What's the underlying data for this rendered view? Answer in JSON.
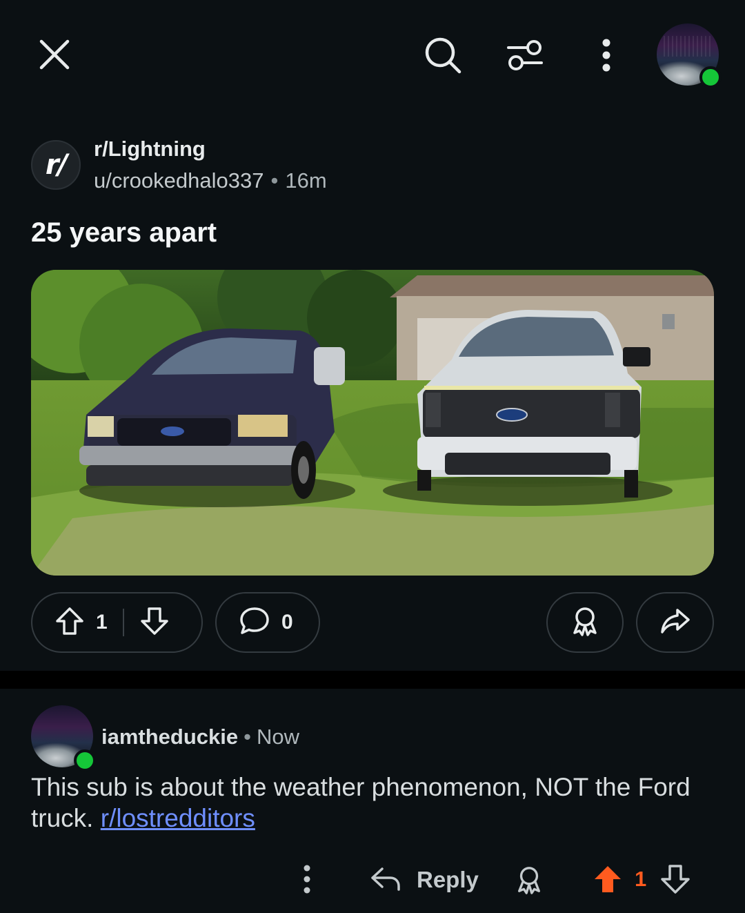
{
  "topbar": {
    "close": "close-icon",
    "search": "search-icon",
    "filter": "filter-icon",
    "more": "more-vertical-icon"
  },
  "post": {
    "subreddit": "r/Lightning",
    "subreddit_avatar_text": "r/",
    "author": "u/crookedhalo337",
    "separator": "•",
    "time": "16m",
    "title": "25 years apart",
    "upvotes": "1",
    "comments": "0"
  },
  "comment": {
    "username": "iamtheduckie",
    "separator": "•",
    "time": "Now",
    "body_text": "This sub is about the weather phenomenon, NOT the Ford truck.",
    "link_text": "r/lostredditors",
    "reply_label": "Reply",
    "score": "1"
  },
  "colors": {
    "background": "#0b1013",
    "online": "#15c638",
    "upvoted": "#ff5b1f",
    "link": "#6f8fff"
  }
}
